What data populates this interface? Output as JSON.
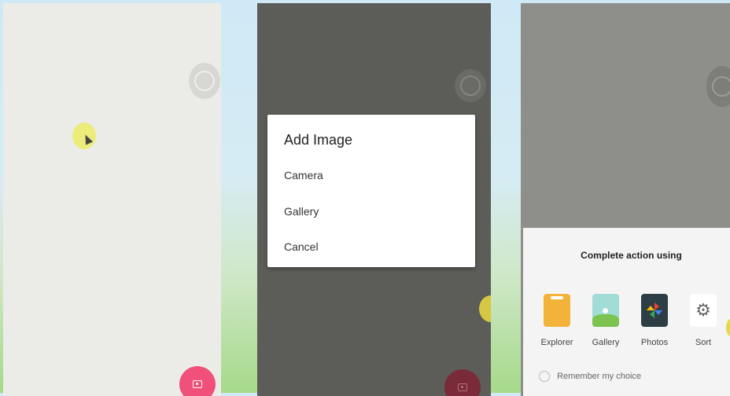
{
  "dialog": {
    "title": "Add Image",
    "options": [
      "Camera",
      "Gallery",
      "Cancel"
    ]
  },
  "chooser": {
    "title": "Complete action using",
    "apps": [
      {
        "label": "Explorer",
        "icon": "explorer-icon"
      },
      {
        "label": "Gallery",
        "icon": "gallery-icon"
      },
      {
        "label": "Photos",
        "icon": "photos-icon"
      },
      {
        "label": "Sort",
        "icon": "settings-gear-icon"
      }
    ],
    "remember_label": "Remember my choice"
  },
  "colors": {
    "fab": "#f0507a",
    "screen1_bg": "#ebece8",
    "dim_overlay": "#5c5d58",
    "cursor_highlight": "#ecec7a"
  }
}
